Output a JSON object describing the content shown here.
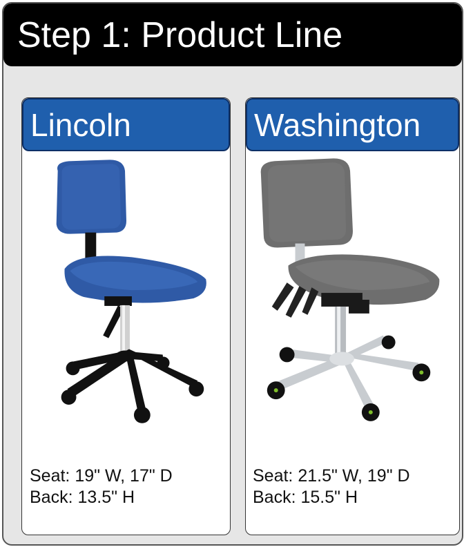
{
  "header": {
    "title": "Step 1: Product Line"
  },
  "products": [
    {
      "name": "Lincoln",
      "image": "blue-fabric-office-chair",
      "seat": "Seat: 19\" W, 17\" D",
      "back": "Back: 13.5\" H",
      "colors": {
        "upholstery": "#2f5aa6",
        "base": "#111111"
      }
    },
    {
      "name": "Washington",
      "image": "gray-fabric-ergonomic-chair",
      "seat": "Seat: 21.5\" W, 19\" D",
      "back": "Back: 15.5\" H",
      "colors": {
        "upholstery": "#6e6e6e",
        "base": "#c8ccd0"
      }
    }
  ],
  "colors": {
    "header_bg": "#000000",
    "card_head_bg": "#1f5fad",
    "panel_bg": "#e6e6e6"
  }
}
